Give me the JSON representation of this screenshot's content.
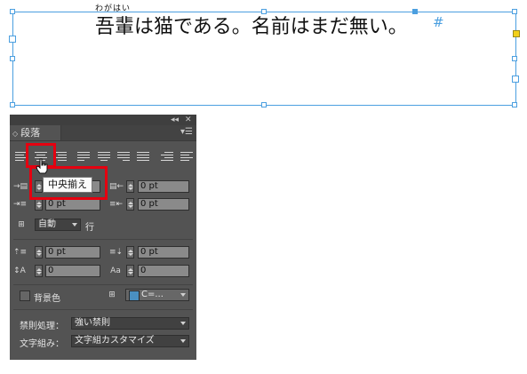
{
  "document": {
    "ruby": "わがはい",
    "text": "吾輩は猫である。名前はまだ無い。",
    "end_mark": "#"
  },
  "panel": {
    "title": "段落",
    "collapse_icon": "double-chevron-left-icon",
    "close_icon": "close-icon",
    "menu_icon": "panel-menu-icon",
    "tooltip": "中央揃え",
    "alignment_buttons": [
      "左揃え",
      "中央揃え",
      "右揃え",
      "均等配置(最終行左揃え)",
      "均等配置(最終行中央揃え)",
      "均等配置(最終行右揃え)",
      "両端揃え",
      "小口揃え",
      "のど揃え"
    ],
    "indent": {
      "left": "",
      "right": "0 pt",
      "first_line": "0 pt",
      "last_line": "0 pt"
    },
    "leading": {
      "mode": "自動",
      "unit": "行"
    },
    "space": {
      "before": "0 pt",
      "after": "0 pt",
      "drop_lines": "0",
      "drop_chars": "0"
    },
    "shading": {
      "label": "背景色",
      "color_value": "C=..."
    },
    "kinsoku": {
      "label": "禁則処理：",
      "value": "強い禁則"
    },
    "mojikumi": {
      "label": "文字組み：",
      "value": "文字組カスタマイズ"
    }
  },
  "colors": {
    "frame": "#4b9fe0",
    "highlight": "#e50010",
    "panel_bg": "#535353"
  }
}
